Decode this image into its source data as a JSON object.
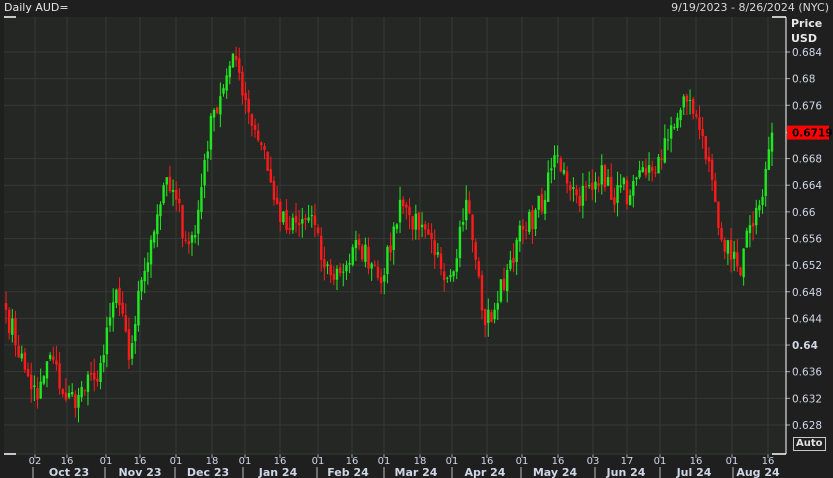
{
  "header": {
    "title": "Daily AUD=",
    "date_range": "9/19/2023 - 8/26/2024 (NYC)"
  },
  "axis": {
    "price_label": "Price",
    "currency_label": "USD",
    "auto_button": "Auto"
  },
  "colors": {
    "up": "#1ee81e",
    "down": "#ff1a1a",
    "last_price_bg": "#ff0000"
  },
  "chart_data": {
    "type": "candlestick",
    "title": "Daily AUD=",
    "ylabel": "Price USD",
    "ylim": [
      0.6256,
      0.6866
    ],
    "y_ticks": [
      "0.684",
      "0.68",
      "0.676",
      "0.6719",
      "0.668",
      "0.664",
      "0.66",
      "0.656",
      "0.652",
      "0.648",
      "0.644",
      "0.64",
      "0.636",
      "0.632",
      "0.628"
    ],
    "y_tick_values": [
      0.684,
      0.68,
      0.676,
      0.6719,
      0.668,
      0.664,
      0.66,
      0.656,
      0.652,
      0.648,
      0.644,
      0.64,
      0.636,
      0.632,
      0.628
    ],
    "last_price": "0.6719",
    "day_ticks": [
      "02",
      "16",
      "01",
      "16",
      "01",
      "18",
      "01",
      "16",
      "01",
      "16",
      "01",
      "18",
      "01",
      "16",
      "01",
      "16",
      "03",
      "17",
      "01",
      "16",
      "01",
      "16"
    ],
    "month_labels": [
      "Oct 23",
      "Nov 23",
      "Dec 23",
      "Jan 24",
      "Feb 24",
      "Mar 24",
      "Apr 24",
      "May 24",
      "Jun 24",
      "Jul 24",
      "Aug 24"
    ],
    "trading_days": 244,
    "close_anchors": [
      [
        0,
        0.6453
      ],
      [
        6,
        0.6363
      ],
      [
        10,
        0.6318
      ],
      [
        14,
        0.6385
      ],
      [
        19,
        0.6318
      ],
      [
        23,
        0.6325
      ],
      [
        28,
        0.6348
      ],
      [
        31,
        0.6385
      ],
      [
        35,
        0.6483
      ],
      [
        39,
        0.6378
      ],
      [
        43,
        0.6498
      ],
      [
        46,
        0.6558
      ],
      [
        50,
        0.664
      ],
      [
        54,
        0.6618
      ],
      [
        57,
        0.6558
      ],
      [
        60,
        0.6565
      ],
      [
        63,
        0.6678
      ],
      [
        66,
        0.6753
      ],
      [
        70,
        0.6805
      ],
      [
        73,
        0.6828
      ],
      [
        76,
        0.6768
      ],
      [
        79,
        0.6723
      ],
      [
        82,
        0.6693
      ],
      [
        85,
        0.6618
      ],
      [
        89,
        0.6573
      ],
      [
        93,
        0.658
      ],
      [
        97,
        0.6595
      ],
      [
        100,
        0.6528
      ],
      [
        103,
        0.6505
      ],
      [
        108,
        0.652
      ],
      [
        112,
        0.655
      ],
      [
        117,
        0.652
      ],
      [
        120,
        0.6505
      ],
      [
        125,
        0.6618
      ],
      [
        128,
        0.6595
      ],
      [
        131,
        0.6573
      ],
      [
        136,
        0.6535
      ],
      [
        141,
        0.6505
      ],
      [
        146,
        0.6618
      ],
      [
        149,
        0.6528
      ],
      [
        152,
        0.643
      ],
      [
        155,
        0.6453
      ],
      [
        159,
        0.6513
      ],
      [
        162,
        0.6558
      ],
      [
        165,
        0.6573
      ],
      [
        168,
        0.6603
      ],
      [
        171,
        0.6618
      ],
      [
        174,
        0.6685
      ],
      [
        177,
        0.6663
      ],
      [
        181,
        0.6625
      ],
      [
        186,
        0.6633
      ],
      [
        189,
        0.667
      ],
      [
        192,
        0.6618
      ],
      [
        195,
        0.664
      ],
      [
        198,
        0.6625
      ],
      [
        203,
        0.6655
      ],
      [
        208,
        0.6678
      ],
      [
        211,
        0.673
      ],
      [
        214,
        0.6753
      ],
      [
        217,
        0.6768
      ],
      [
        220,
        0.6723
      ],
      [
        224,
        0.6648
      ],
      [
        227,
        0.6558
      ],
      [
        230,
        0.6528
      ],
      [
        233,
        0.6505
      ],
      [
        236,
        0.658
      ],
      [
        239,
        0.661
      ],
      [
        243,
        0.6719
      ]
    ]
  }
}
